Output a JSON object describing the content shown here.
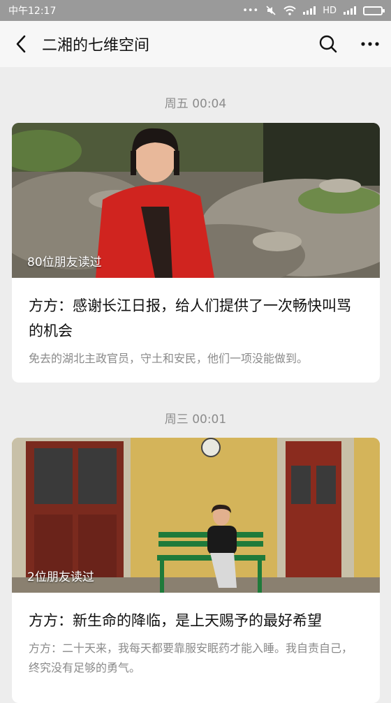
{
  "status_bar": {
    "time": "中午12:17",
    "network": "HD"
  },
  "nav": {
    "title": "二湘的七维空间"
  },
  "articles": [
    {
      "time": "周五 00:04",
      "read_count": "80位朋友读过",
      "title": "方方：感谢长江日报，给人们提供了一次畅快叫骂的机会",
      "digest": "免去的湖北主政官员，守土和安民，他们一项没能做到。"
    },
    {
      "time": "周三 00:01",
      "read_count": "2位朋友读过",
      "title": "方方：新生命的降临，是上天赐予的最好希望",
      "digest": "方方：二十天来，我每天都要靠服安眠药才能入睡。我自责自己，终究没有足够的勇气。"
    }
  ],
  "colors": {
    "background": "#ededed",
    "status_bar": "#9a9a9a",
    "card": "#ffffff"
  }
}
